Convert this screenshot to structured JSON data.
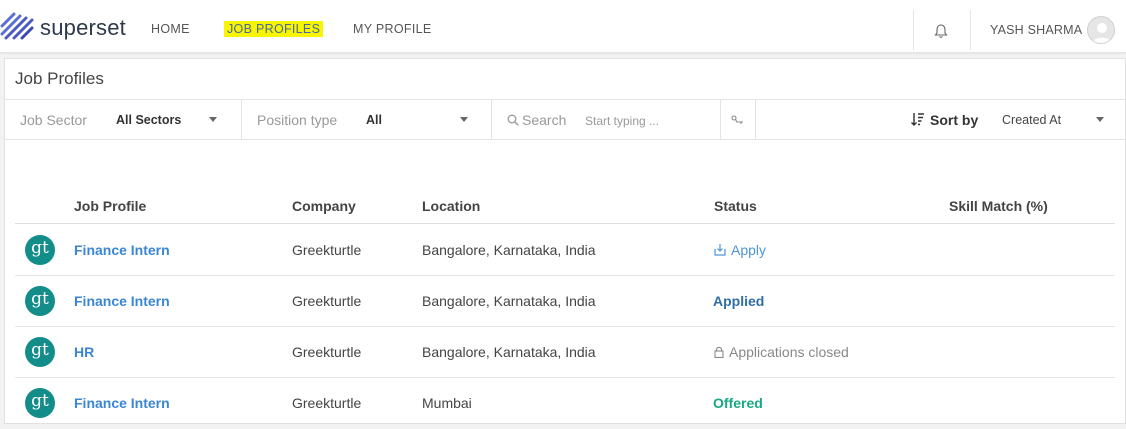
{
  "nav": {
    "brand": "superset",
    "items": [
      {
        "label": "HOME"
      },
      {
        "label": "JOB PROFILES"
      },
      {
        "label": "MY PROFILE"
      }
    ],
    "user_name": "YASH SHARMA"
  },
  "page": {
    "title": "Job Profiles"
  },
  "filters": {
    "job_sector": {
      "label": "Job Sector",
      "value": "All Sectors"
    },
    "position_type": {
      "label": "Position type",
      "value": "All"
    },
    "search": {
      "label": "Search",
      "placeholder": "Start typing ..."
    },
    "sort": {
      "label": "Sort by",
      "value": "Created At"
    }
  },
  "table": {
    "columns": [
      "Job Profile",
      "Company",
      "Location",
      "Status",
      "Skill Match (%)"
    ],
    "rows": [
      {
        "logo": "gt",
        "profile": "Finance Intern",
        "company": "Greekturtle",
        "location": "Bangalore, Karnataka, India",
        "status": "Apply",
        "status_kind": "apply"
      },
      {
        "logo": "gt",
        "profile": "Finance Intern",
        "company": "Greekturtle",
        "location": "Bangalore, Karnataka, India",
        "status": "Applied",
        "status_kind": "applied"
      },
      {
        "logo": "gt",
        "profile": "HR",
        "company": "Greekturtle",
        "location": "Bangalore, Karnataka, India",
        "status": "Applications closed",
        "status_kind": "closed"
      },
      {
        "logo": "gt",
        "profile": "Finance Intern",
        "company": "Greekturtle",
        "location": "Mumbai",
        "status": "Offered",
        "status_kind": "offered"
      }
    ]
  },
  "colors": {
    "highlight": "#f7f500",
    "link": "#3b86d4",
    "logo_bg": "#138d8a",
    "offered": "#19a883"
  }
}
